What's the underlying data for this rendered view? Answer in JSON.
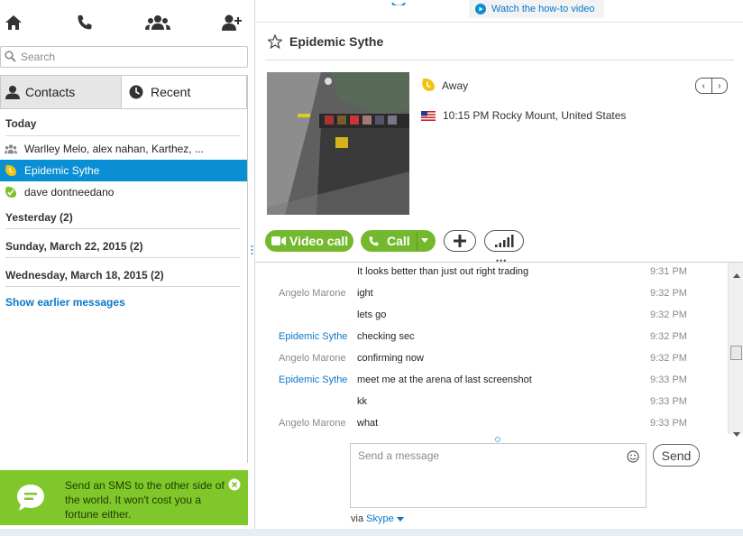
{
  "left": {
    "search_placeholder": "Search",
    "tabs": {
      "contacts": "Contacts",
      "recent": "Recent"
    },
    "sections": {
      "today": "Today",
      "yesterday": "Yesterday (2)",
      "sunday": "Sunday, March 22, 2015 (2)",
      "wednesday": "Wednesday, March 18, 2015 (2)"
    },
    "conversations": [
      {
        "name": "Warlley Melo, alex nahan, Karthez, ..."
      },
      {
        "name": "Epidemic Sythe"
      },
      {
        "name": "dave dontneedano"
      }
    ],
    "show_earlier": "Show earlier messages",
    "sms_banner": "Send an SMS to the other side of the world. It won't cost you a fortune either."
  },
  "right": {
    "howto_link": "Watch the how-to video",
    "contact_name": "Epidemic Sythe",
    "status": "Away",
    "location": "10:15 PM Rocky Mount, United States",
    "buttons": {
      "video_call": "Video call",
      "call": "Call"
    },
    "messages": [
      {
        "sender": "",
        "text": "It looks better than just out right trading",
        "time": "9:31 PM"
      },
      {
        "sender": "Angelo Marone",
        "text": "ight",
        "time": "9:32 PM"
      },
      {
        "sender": "",
        "text": "lets go",
        "time": "9:32 PM"
      },
      {
        "sender": "Epidemic Sythe",
        "text": "checking sec",
        "time": "9:32 PM"
      },
      {
        "sender": "Angelo Marone",
        "text": "confirming now",
        "time": "9:32 PM"
      },
      {
        "sender": "Epidemic Sythe",
        "text": "meet me at the arena of last screenshot",
        "time": "9:33 PM"
      },
      {
        "sender": "",
        "text": "kk",
        "time": "9:33 PM"
      },
      {
        "sender": "Angelo Marone",
        "text": "what",
        "time": "9:33 PM"
      }
    ],
    "compose_placeholder": "Send a message",
    "send_label": "Send",
    "via_label": "via",
    "via_service": "Skype"
  },
  "colors": {
    "accent_blue": "#0a8fd4",
    "skype_green": "#74b82d",
    "banner_green": "#7fc72b",
    "away_yellow": "#f4c20d"
  },
  "icons": [
    "home-icon",
    "phone-icon",
    "group-icon",
    "add-contact-icon",
    "search-icon",
    "person-icon",
    "clock-icon",
    "star-icon",
    "away-status-icon",
    "us-flag-icon",
    "video-icon",
    "plus-icon",
    "signal-icon",
    "emoji-icon",
    "play-icon",
    "chat-bubble-icon",
    "close-icon"
  ]
}
